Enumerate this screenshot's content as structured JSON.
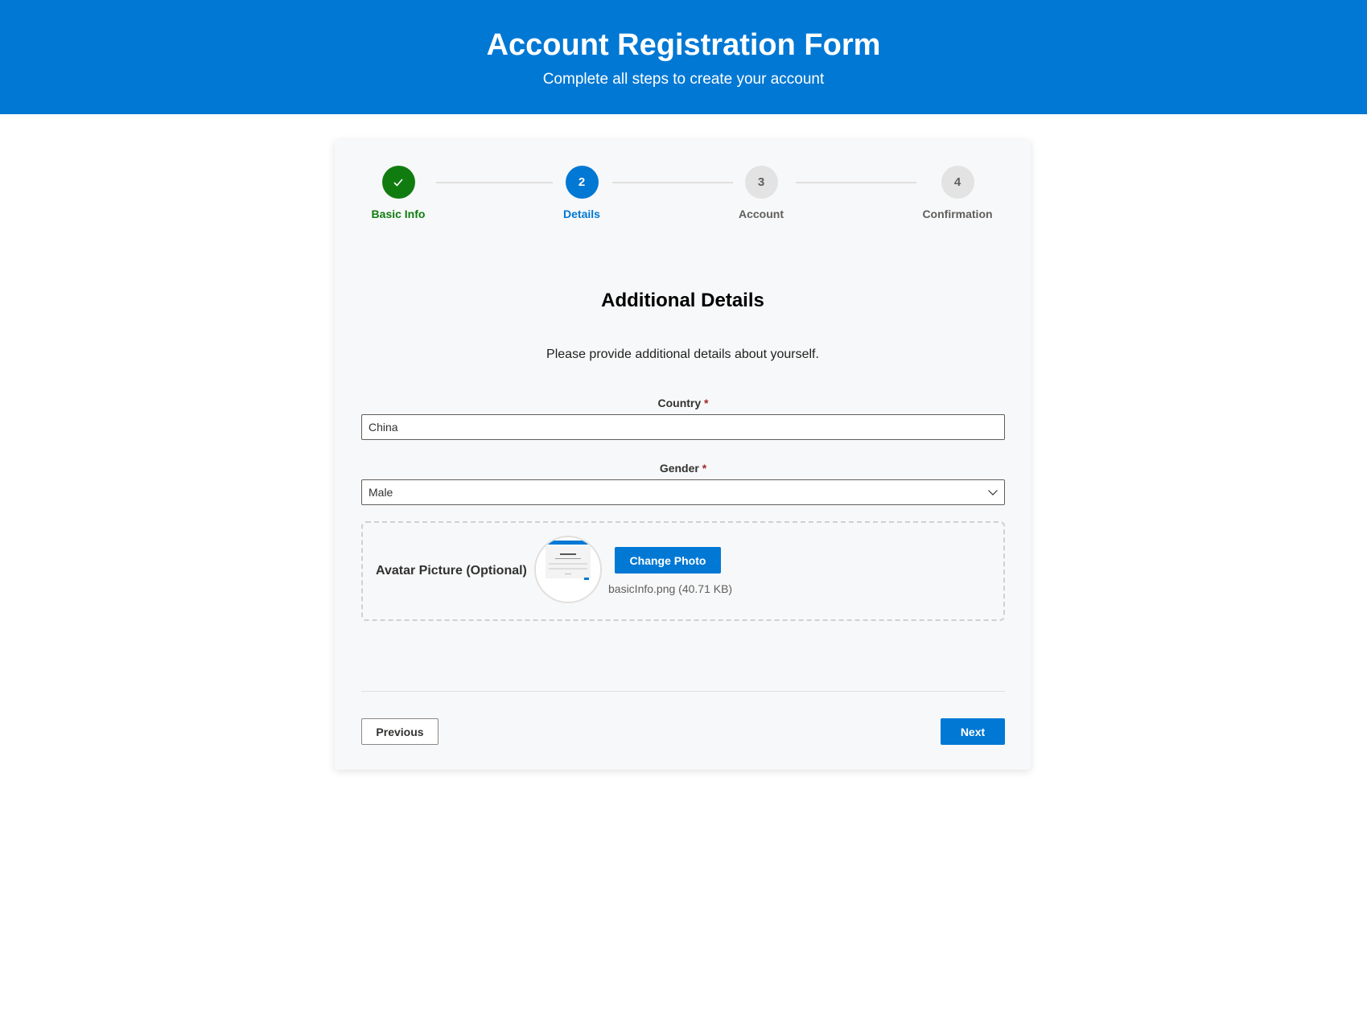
{
  "header": {
    "title": "Account Registration Form",
    "subtitle": "Complete all steps to create your account",
    "background_color": "#0078d4"
  },
  "stepper": {
    "steps": [
      {
        "number": "1",
        "label": "Basic Info",
        "state": "completed",
        "icon": "check-icon"
      },
      {
        "number": "2",
        "label": "Details",
        "state": "active"
      },
      {
        "number": "3",
        "label": "Account",
        "state": "pending"
      },
      {
        "number": "4",
        "label": "Confirmation",
        "state": "pending"
      }
    ],
    "completed_color": "#107c10",
    "active_color": "#0078d4",
    "pending_color": "#e3e3e3"
  },
  "section": {
    "title": "Additional Details",
    "description": "Please provide additional details about yourself."
  },
  "form": {
    "country": {
      "label": "Country",
      "required_mark": "*",
      "value": "China"
    },
    "gender": {
      "label": "Gender",
      "required_mark": "*",
      "selected": "Male",
      "icon": "chevron-down-icon"
    },
    "avatar": {
      "label": "Avatar Picture (Optional)",
      "change_button": "Change Photo",
      "file_info": "basicInfo.png (40.71 KB)"
    }
  },
  "navigation": {
    "previous_label": "Previous",
    "next_label": "Next"
  }
}
